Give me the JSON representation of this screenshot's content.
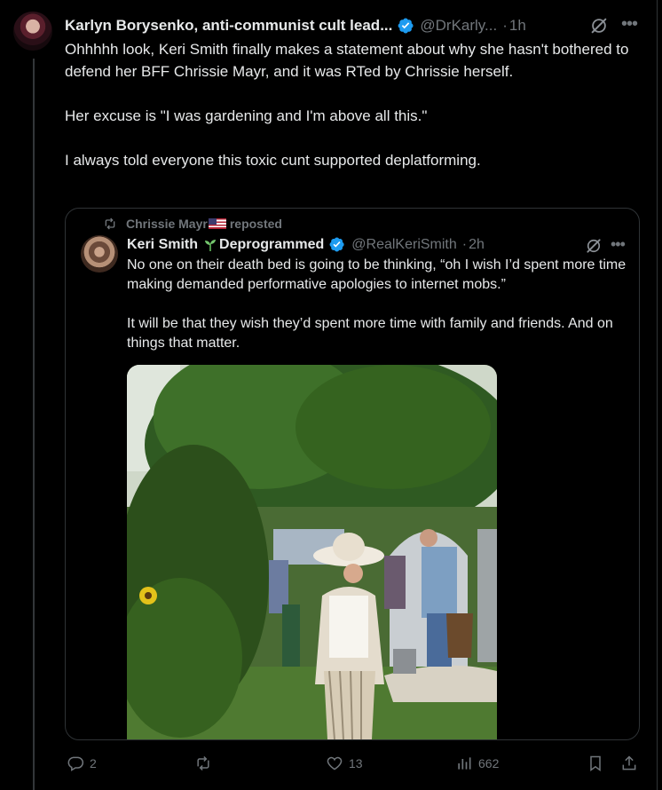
{
  "tweet": {
    "author_name": "Karlyn Borysenko, anti-communist cult lead...",
    "handle": "@DrKarly...",
    "separator": "·",
    "time": "1h",
    "paragraphs": [
      "Ohhhhh look, Keri Smith finally makes a statement about why she hasn't bothered to defend her BFF Chrissie Mayr, and it was RTed by Chrissie herself.",
      "Her excuse is \"I was gardening and I'm above all this.\"",
      "I always told everyone this toxic cunt supported deplatforming."
    ]
  },
  "quote": {
    "reposter": "Chrissie Mayr",
    "reposted_label": "reposted",
    "author_name": "Keri Smith",
    "author_suffix": "Deprogrammed",
    "handle": "@RealKeriSmith",
    "separator": "·",
    "time": "2h",
    "paragraphs": [
      "No one on their death bed is going to be thinking, “oh I wish I’d spent more time making demanded performative apologies to internet mobs.”",
      "It will be that they wish they’d spent more time with family and friends. And on things that matter."
    ]
  },
  "actions": {
    "replies": "2",
    "reposts": "",
    "likes": "13",
    "views": "662"
  },
  "icons": {
    "verified": "verified-badge-icon",
    "grok": "grok-icon",
    "more": "more-icon",
    "repost": "repost-icon",
    "reply": "reply-icon",
    "like": "heart-icon",
    "views": "views-icon",
    "bookmark": "bookmark-icon",
    "share": "share-icon",
    "sprout": "sprout-emoji-icon",
    "flag": "us-flag-emoji-icon"
  },
  "colors": {
    "background": "#000000",
    "text": "#e7e9ea",
    "secondary": "#71767b",
    "verified": "#1d9bf0",
    "border": "#2f3336"
  }
}
